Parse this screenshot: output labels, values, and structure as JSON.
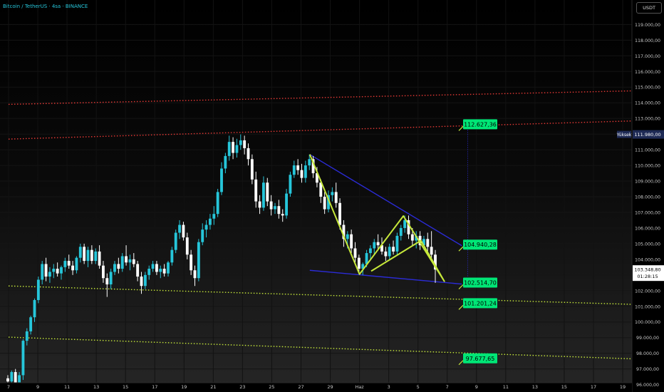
{
  "header": {
    "title": "Bitcoin / TetherUS · 4sa · BINANCE",
    "currency": "USDT"
  },
  "chart_data": {
    "type": "candlestick",
    "title": "Bitcoin / TetherUS · 4sa · BINANCE",
    "ylim": [
      95800,
      120200
    ],
    "y_ticks": [
      96000,
      97000,
      98000,
      99000,
      100000,
      101000,
      102000,
      103000,
      104000,
      105000,
      106000,
      107000,
      108000,
      109000,
      110000,
      111000,
      112000,
      113000,
      114000,
      115000,
      116000,
      117000,
      118000,
      119000
    ],
    "y_tick_labels": [
      "96.000,00",
      "97.000,00",
      "98.000,00",
      "99.000,00",
      "100.000,00",
      "101.000,00",
      "102.000,00",
      "103.000,00",
      "104.000,00",
      "105.000,00",
      "106.000,00",
      "107.000,00",
      "108.000,00",
      "109.000,00",
      "110.000,00",
      "111.000,00",
      "112.000,00",
      "113.000,00",
      "114.000,00",
      "115.000,00",
      "116.000,00",
      "117.000,00",
      "118.000,00",
      "119.000,00"
    ],
    "x_ticks": [
      "7",
      "9",
      "11",
      "13",
      "15",
      "17",
      "19",
      "21",
      "23",
      "25",
      "27",
      "29",
      "Haz",
      "3",
      "5",
      "7",
      "9",
      "11",
      "13",
      "15",
      "17",
      "19"
    ],
    "high_label": {
      "label": "Yüksek",
      "value": "111.980,00",
      "price": 111980
    },
    "last_price": {
      "value": "103.348,80",
      "countdown": "01:28:15",
      "price": 103348.8
    },
    "level_labels": [
      {
        "text": "112.627,36",
        "price": 112627.36
      },
      {
        "text": "104.940,28",
        "price": 104940.28
      },
      {
        "text": "102.514,70",
        "price": 102514.7
      },
      {
        "text": "101.201,24",
        "price": 101201.24
      },
      {
        "text": "97.677,65",
        "price": 97677.65
      }
    ],
    "trend_lines": [
      {
        "style": "red-dotted",
        "x_start": 0,
        "y_start": 113900,
        "x_end": 28.5,
        "y_end": 115050
      },
      {
        "style": "red-dotted",
        "x_start": 0,
        "y_start": 111680,
        "x_end": 28.5,
        "y_end": 113230
      },
      {
        "style": "green-dotted",
        "x_start": 0,
        "y_start": 102300,
        "x_end": 28.5,
        "y_end": 100730
      },
      {
        "style": "green-dotted",
        "x_start": 0,
        "y_start": 99030,
        "x_end": 28.5,
        "y_end": 97180
      },
      {
        "style": "blue",
        "x_start": 10.3,
        "y_start": 110700,
        "x_end": 15.5,
        "y_end": 104870
      },
      {
        "style": "blue",
        "x_start": 10.3,
        "y_start": 103300,
        "x_end": 15.5,
        "y_end": 102420
      },
      {
        "style": "blue-dotted",
        "x_start": 15.7,
        "y_start": 102650,
        "x_end": 15.7,
        "y_end": 112600
      }
    ],
    "pattern_path": [
      {
        "x": 10.3,
        "y": 110700
      },
      {
        "x": 12.0,
        "y": 103050
      },
      {
        "x": 13.5,
        "y": 106770
      },
      {
        "x": 14.9,
        "y": 102600
      },
      {
        "x": 14.1,
        "y": 105200
      },
      {
        "x": 12.4,
        "y": 103250
      }
    ],
    "candles": [
      {
        "o": 96400,
        "h": 96600,
        "l": 96000,
        "c": 96200
      },
      {
        "o": 96200,
        "h": 96900,
        "l": 96000,
        "c": 96800
      },
      {
        "o": 96800,
        "h": 97000,
        "l": 96000,
        "c": 96100
      },
      {
        "o": 96100,
        "h": 96800,
        "l": 96000,
        "c": 96600
      },
      {
        "o": 96600,
        "h": 98900,
        "l": 96300,
        "c": 98800
      },
      {
        "o": 98800,
        "h": 99600,
        "l": 98500,
        "c": 99400
      },
      {
        "o": 99400,
        "h": 100400,
        "l": 99200,
        "c": 100300
      },
      {
        "o": 100300,
        "h": 101500,
        "l": 100000,
        "c": 101400
      },
      {
        "o": 101400,
        "h": 102900,
        "l": 101200,
        "c": 102700
      },
      {
        "o": 102700,
        "h": 103900,
        "l": 102400,
        "c": 103700
      },
      {
        "o": 103700,
        "h": 104100,
        "l": 102600,
        "c": 102900
      },
      {
        "o": 102900,
        "h": 103500,
        "l": 102500,
        "c": 103200
      },
      {
        "o": 103200,
        "h": 103700,
        "l": 102800,
        "c": 103400
      },
      {
        "o": 103400,
        "h": 103800,
        "l": 102900,
        "c": 103100
      },
      {
        "o": 103100,
        "h": 103600,
        "l": 102700,
        "c": 103500
      },
      {
        "o": 103500,
        "h": 104100,
        "l": 103200,
        "c": 103900
      },
      {
        "o": 103900,
        "h": 104300,
        "l": 103400,
        "c": 103600
      },
      {
        "o": 103600,
        "h": 103900,
        "l": 103000,
        "c": 103300
      },
      {
        "o": 103300,
        "h": 104200,
        "l": 103100,
        "c": 104100
      },
      {
        "o": 104100,
        "h": 105000,
        "l": 103800,
        "c": 104800
      },
      {
        "o": 104800,
        "h": 105000,
        "l": 103700,
        "c": 103900
      },
      {
        "o": 103900,
        "h": 104800,
        "l": 103500,
        "c": 104600
      },
      {
        "o": 104600,
        "h": 104900,
        "l": 103700,
        "c": 103900
      },
      {
        "o": 103900,
        "h": 104700,
        "l": 103700,
        "c": 104500
      },
      {
        "o": 104500,
        "h": 104900,
        "l": 103400,
        "c": 103600
      },
      {
        "o": 103600,
        "h": 103900,
        "l": 102500,
        "c": 102800
      },
      {
        "o": 102800,
        "h": 103100,
        "l": 101600,
        "c": 102400
      },
      {
        "o": 102400,
        "h": 103400,
        "l": 102100,
        "c": 103200
      },
      {
        "o": 103200,
        "h": 103900,
        "l": 103000,
        "c": 103700
      },
      {
        "o": 103700,
        "h": 104100,
        "l": 103100,
        "c": 103400
      },
      {
        "o": 103400,
        "h": 104400,
        "l": 103200,
        "c": 104200
      },
      {
        "o": 104200,
        "h": 104900,
        "l": 103600,
        "c": 103800
      },
      {
        "o": 103800,
        "h": 104300,
        "l": 103300,
        "c": 104000
      },
      {
        "o": 104000,
        "h": 104400,
        "l": 103500,
        "c": 103700
      },
      {
        "o": 103700,
        "h": 103900,
        "l": 102600,
        "c": 102900
      },
      {
        "o": 102900,
        "h": 103200,
        "l": 101800,
        "c": 102300
      },
      {
        "o": 102300,
        "h": 103200,
        "l": 102100,
        "c": 103000
      },
      {
        "o": 103000,
        "h": 103600,
        "l": 102700,
        "c": 103400
      },
      {
        "o": 103400,
        "h": 103900,
        "l": 103200,
        "c": 103700
      },
      {
        "o": 103700,
        "h": 103900,
        "l": 103000,
        "c": 103200
      },
      {
        "o": 103200,
        "h": 103600,
        "l": 102800,
        "c": 103400
      },
      {
        "o": 103400,
        "h": 103700,
        "l": 102900,
        "c": 103100
      },
      {
        "o": 103100,
        "h": 103900,
        "l": 102900,
        "c": 103800
      },
      {
        "o": 103800,
        "h": 104800,
        "l": 103600,
        "c": 104600
      },
      {
        "o": 104600,
        "h": 105900,
        "l": 104400,
        "c": 105700
      },
      {
        "o": 105700,
        "h": 106500,
        "l": 105300,
        "c": 106200
      },
      {
        "o": 106200,
        "h": 106400,
        "l": 105200,
        "c": 105400
      },
      {
        "o": 105400,
        "h": 105700,
        "l": 104000,
        "c": 104300
      },
      {
        "o": 104300,
        "h": 104600,
        "l": 103000,
        "c": 103300
      },
      {
        "o": 103300,
        "h": 103600,
        "l": 102300,
        "c": 102800
      },
      {
        "o": 102800,
        "h": 105300,
        "l": 102600,
        "c": 105100
      },
      {
        "o": 105100,
        "h": 106300,
        "l": 104900,
        "c": 105900
      },
      {
        "o": 105900,
        "h": 106500,
        "l": 105400,
        "c": 106200
      },
      {
        "o": 106200,
        "h": 106900,
        "l": 105900,
        "c": 106600
      },
      {
        "o": 106600,
        "h": 107400,
        "l": 106200,
        "c": 106900
      },
      {
        "o": 106900,
        "h": 108500,
        "l": 106700,
        "c": 108300
      },
      {
        "o": 108300,
        "h": 110200,
        "l": 108100,
        "c": 109800
      },
      {
        "o": 109800,
        "h": 110800,
        "l": 109500,
        "c": 110600
      },
      {
        "o": 110600,
        "h": 111900,
        "l": 110300,
        "c": 111500
      },
      {
        "o": 111500,
        "h": 111800,
        "l": 110400,
        "c": 110800
      },
      {
        "o": 110800,
        "h": 111700,
        "l": 110500,
        "c": 111300
      },
      {
        "o": 111300,
        "h": 111980,
        "l": 111000,
        "c": 111600
      },
      {
        "o": 111600,
        "h": 111900,
        "l": 110700,
        "c": 111100
      },
      {
        "o": 111100,
        "h": 111400,
        "l": 110000,
        "c": 110400
      },
      {
        "o": 110400,
        "h": 110700,
        "l": 108800,
        "c": 109100
      },
      {
        "o": 109100,
        "h": 109600,
        "l": 107300,
        "c": 107700
      },
      {
        "o": 107700,
        "h": 108100,
        "l": 106900,
        "c": 107300
      },
      {
        "o": 107300,
        "h": 109300,
        "l": 107100,
        "c": 108900
      },
      {
        "o": 108900,
        "h": 109200,
        "l": 107400,
        "c": 107700
      },
      {
        "o": 107700,
        "h": 108100,
        "l": 106800,
        "c": 107200
      },
      {
        "o": 107200,
        "h": 107600,
        "l": 106900,
        "c": 107400
      },
      {
        "o": 107400,
        "h": 107800,
        "l": 106600,
        "c": 106900
      },
      {
        "o": 106900,
        "h": 107200,
        "l": 106400,
        "c": 106800
      },
      {
        "o": 106800,
        "h": 108500,
        "l": 106600,
        "c": 108200
      },
      {
        "o": 108200,
        "h": 109600,
        "l": 108000,
        "c": 109400
      },
      {
        "o": 109400,
        "h": 110300,
        "l": 109200,
        "c": 110000
      },
      {
        "o": 110000,
        "h": 110400,
        "l": 109400,
        "c": 109700
      },
      {
        "o": 109700,
        "h": 110100,
        "l": 108900,
        "c": 109200
      },
      {
        "o": 109200,
        "h": 110300,
        "l": 108900,
        "c": 110000
      },
      {
        "o": 110000,
        "h": 110700,
        "l": 109700,
        "c": 110400
      },
      {
        "o": 110400,
        "h": 110600,
        "l": 109200,
        "c": 109500
      },
      {
        "o": 109500,
        "h": 109900,
        "l": 108600,
        "c": 108900
      },
      {
        "o": 108900,
        "h": 109100,
        "l": 107600,
        "c": 108000
      },
      {
        "o": 108000,
        "h": 108300,
        "l": 106900,
        "c": 107200
      },
      {
        "o": 107200,
        "h": 108400,
        "l": 107000,
        "c": 108100
      },
      {
        "o": 108100,
        "h": 108600,
        "l": 107700,
        "c": 108300
      },
      {
        "o": 108300,
        "h": 108900,
        "l": 107300,
        "c": 107600
      },
      {
        "o": 107600,
        "h": 107900,
        "l": 105900,
        "c": 106200
      },
      {
        "o": 106200,
        "h": 106500,
        "l": 104800,
        "c": 105300
      },
      {
        "o": 105300,
        "h": 105800,
        "l": 104700,
        "c": 105600
      },
      {
        "o": 105600,
        "h": 105900,
        "l": 104400,
        "c": 104700
      },
      {
        "o": 104700,
        "h": 105100,
        "l": 103800,
        "c": 104100
      },
      {
        "o": 104100,
        "h": 104300,
        "l": 103100,
        "c": 103400
      },
      {
        "o": 103400,
        "h": 103800,
        "l": 103000,
        "c": 103700
      },
      {
        "o": 103700,
        "h": 104600,
        "l": 103500,
        "c": 104400
      },
      {
        "o": 104400,
        "h": 104900,
        "l": 104000,
        "c": 104700
      },
      {
        "o": 104700,
        "h": 105300,
        "l": 104300,
        "c": 105100
      },
      {
        "o": 105100,
        "h": 105600,
        "l": 104600,
        "c": 104900
      },
      {
        "o": 104900,
        "h": 105400,
        "l": 104300,
        "c": 104500
      },
      {
        "o": 104500,
        "h": 104800,
        "l": 103900,
        "c": 104200
      },
      {
        "o": 104200,
        "h": 105000,
        "l": 104000,
        "c": 104800
      },
      {
        "o": 104800,
        "h": 105200,
        "l": 104300,
        "c": 104500
      },
      {
        "o": 104500,
        "h": 105700,
        "l": 104300,
        "c": 105500
      },
      {
        "o": 105500,
        "h": 106200,
        "l": 105200,
        "c": 106000
      },
      {
        "o": 106000,
        "h": 106800,
        "l": 105700,
        "c": 106500
      },
      {
        "o": 106500,
        "h": 106800,
        "l": 105300,
        "c": 105600
      },
      {
        "o": 105600,
        "h": 106000,
        "l": 104900,
        "c": 105200
      },
      {
        "o": 105200,
        "h": 105800,
        "l": 104700,
        "c": 105500
      },
      {
        "o": 105500,
        "h": 105800,
        "l": 104600,
        "c": 104900
      },
      {
        "o": 104900,
        "h": 105500,
        "l": 104600,
        "c": 105300
      },
      {
        "o": 105300,
        "h": 105700,
        "l": 104500,
        "c": 104800
      },
      {
        "o": 104800,
        "h": 105800,
        "l": 104100,
        "c": 104300
      },
      {
        "o": 104300,
        "h": 104600,
        "l": 102500,
        "c": 103349
      }
    ]
  }
}
